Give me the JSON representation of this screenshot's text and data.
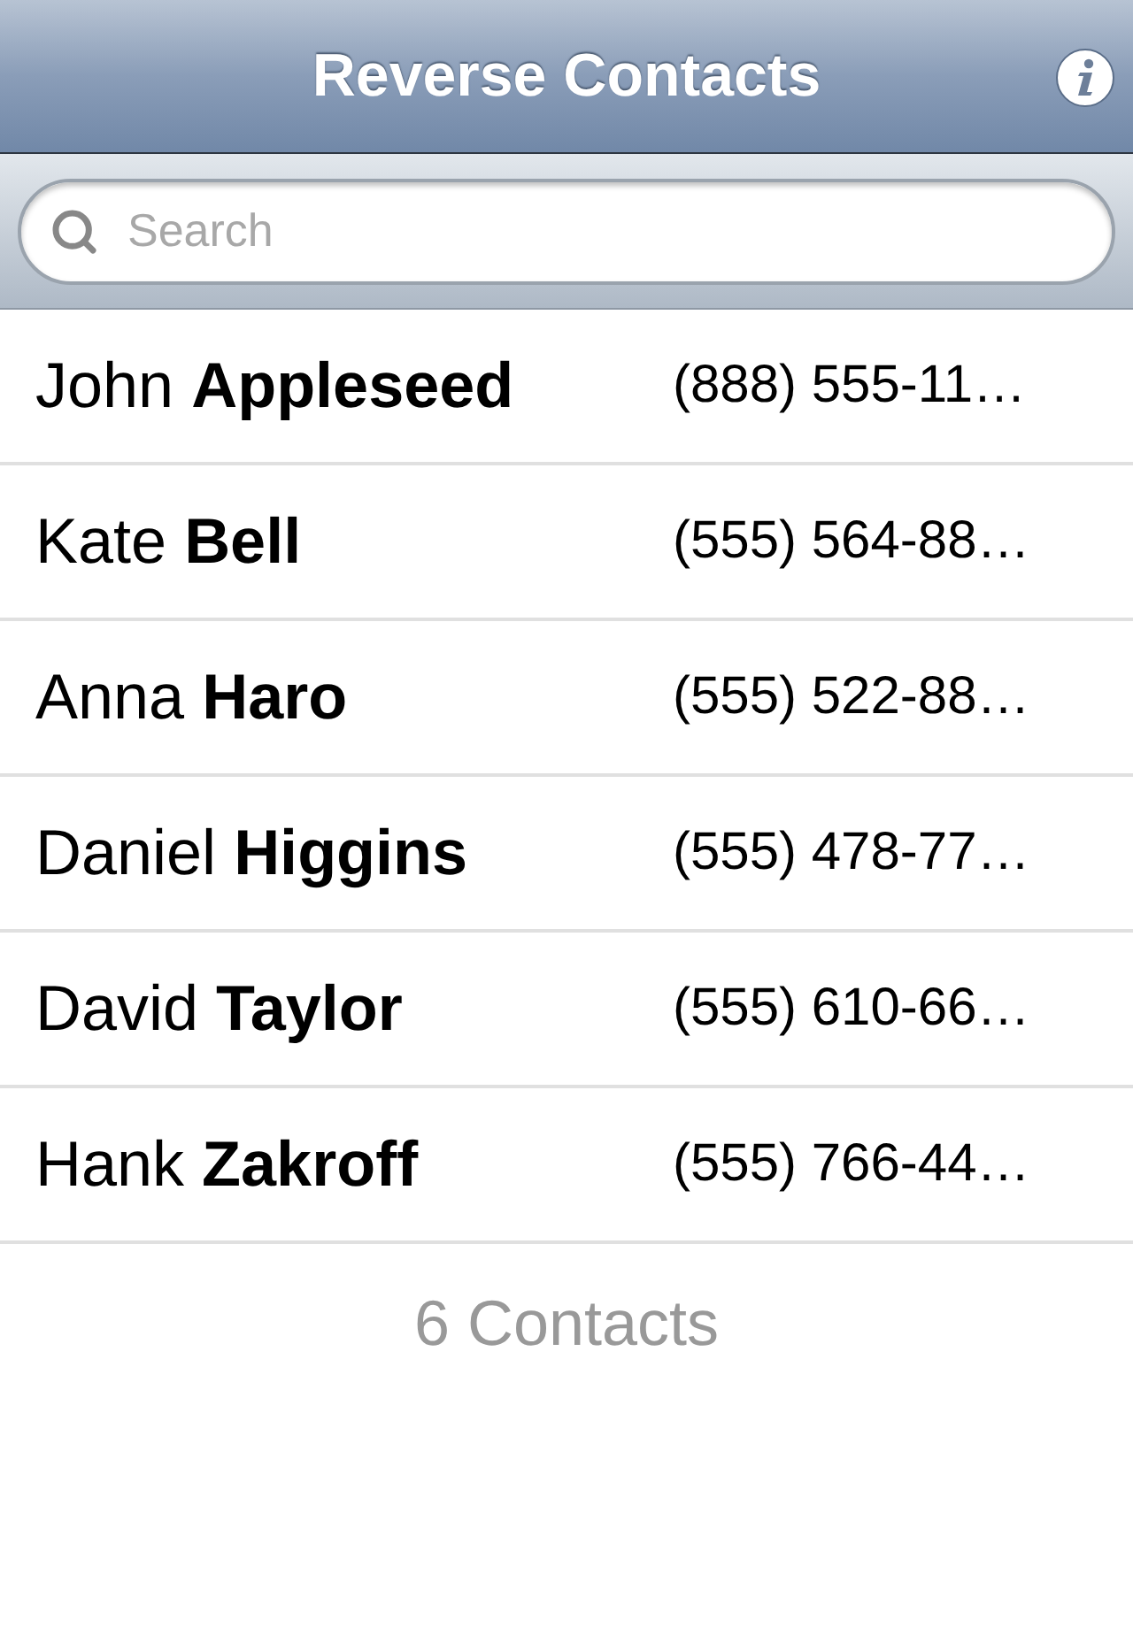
{
  "nav_bar": {
    "title": "Reverse Contacts"
  },
  "search": {
    "placeholder": "Search"
  },
  "contacts": [
    {
      "name": "John **Appleseed**",
      "phone": "(888) 555-11…"
    },
    {
      "name": "Kate **Bell**",
      "phone": "(555) 564-88…"
    },
    {
      "name": "Anna **Haro**",
      "phone": "(555) 522-88…"
    },
    {
      "name": "Daniel **Higgins**",
      "phone": "(555) 478-77…"
    },
    {
      "name": "David **Taylor**",
      "phone": "(555) 610-66…"
    },
    {
      "name": "Hank **Zakroff**",
      "phone": "(555) 766-44…"
    }
  ],
  "footer": "6 Contacts"
}
